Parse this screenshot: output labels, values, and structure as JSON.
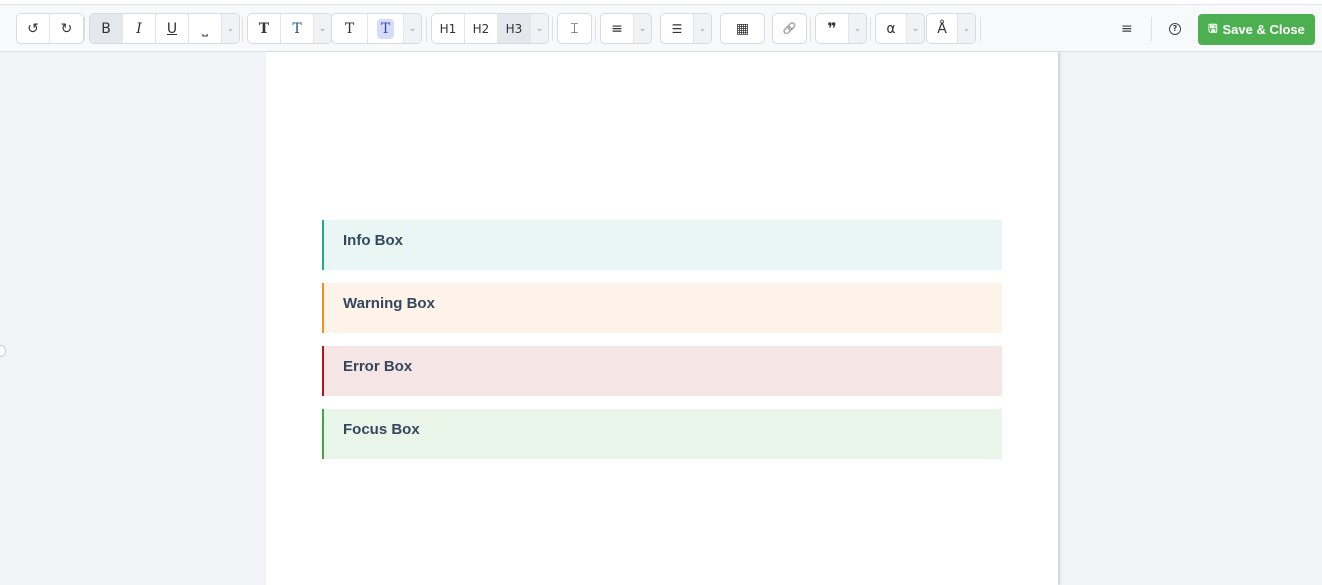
{
  "toolbar": {
    "undo": "↺",
    "redo": "↻",
    "bold": "B",
    "italic": "I",
    "underline": "U",
    "space": "⎵",
    "chevron": "⌄",
    "text_color": "T",
    "heading_h1": "H1",
    "heading_h2": "H2",
    "heading_h3": "H3",
    "hr": "⌶",
    "align": "≡",
    "list": "☰",
    "table": "▦",
    "link": "🔗",
    "quote": "❞",
    "alpha": "α",
    "ring": "Å",
    "menu": "≡",
    "help": "?",
    "save_label": "Save & Close",
    "save_icon": "🖫"
  },
  "boxes": [
    {
      "label": "Info Box",
      "border": "#26a98b",
      "bg": "#e9f6f3"
    },
    {
      "label": "Warning Box",
      "border": "#f0901e",
      "bg": "#fdf3e8"
    },
    {
      "label": "Error Box",
      "border": "#b0181f",
      "bg": "#f5e6e5"
    },
    {
      "label": "Focus Box",
      "border": "#43a545",
      "bg": "#eaf5e9"
    }
  ]
}
